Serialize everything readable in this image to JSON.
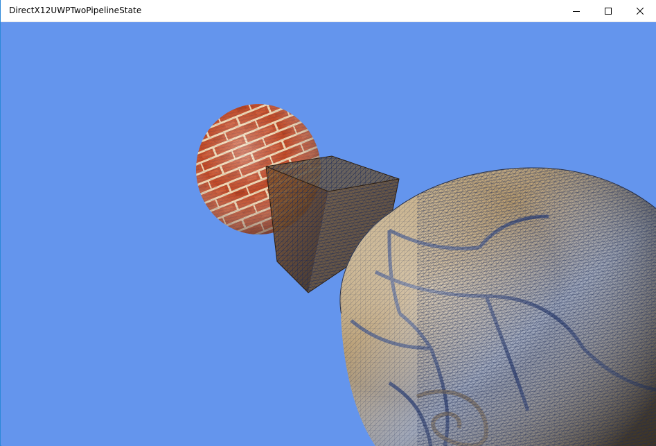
{
  "window": {
    "title": "DirectX12UWPTwoPipelineState",
    "controls": {
      "minimize_icon": "minimize-icon",
      "maximize_icon": "maximize-icon",
      "close_icon": "close-icon"
    }
  },
  "scene": {
    "clear_color": "#6495ed",
    "objects": [
      "brick-sphere",
      "wireframe-cube",
      "stone-sphere"
    ]
  },
  "colors": {
    "accent_border": "#2b88d8",
    "brick": "#c8502a",
    "mortar": "#f2d7b0",
    "wire": "#1b2a55"
  }
}
